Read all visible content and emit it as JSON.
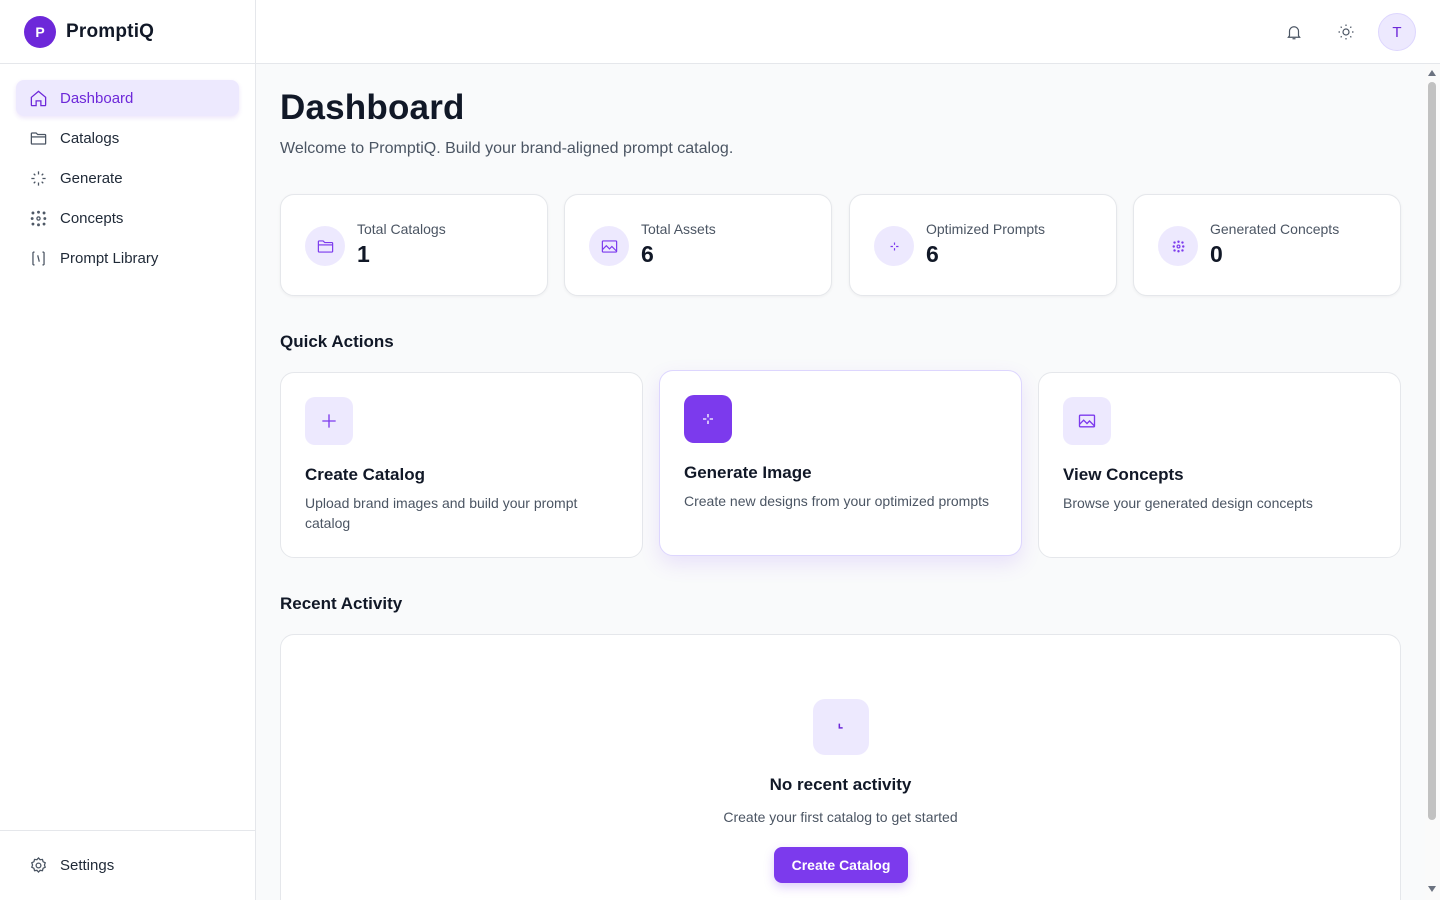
{
  "brand": {
    "logo_letter": "P",
    "name": "PromptiQ"
  },
  "sidebar": {
    "items": [
      {
        "label": "Dashboard",
        "icon": "home-icon",
        "active": true
      },
      {
        "label": "Catalogs",
        "icon": "folder-icon",
        "active": false
      },
      {
        "label": "Generate",
        "icon": "sparkles-icon",
        "active": false
      },
      {
        "label": "Concepts",
        "icon": "concepts-icon",
        "active": false
      },
      {
        "label": "Prompt Library",
        "icon": "library-icon",
        "active": false
      }
    ],
    "settings": {
      "label": "Settings",
      "icon": "gear-icon"
    }
  },
  "topbar": {
    "icons": [
      "bell-icon",
      "sun-icon"
    ],
    "avatar_letter": "T"
  },
  "page": {
    "title": "Dashboard",
    "subtitle": "Welcome to PromptiQ. Build your brand-aligned prompt catalog."
  },
  "stats": [
    {
      "label": "Total Catalogs",
      "value": "1",
      "icon": "folder-icon"
    },
    {
      "label": "Total Assets",
      "value": "6",
      "icon": "image-icon"
    },
    {
      "label": "Optimized Prompts",
      "value": "6",
      "icon": "sparkles-icon"
    },
    {
      "label": "Generated Concepts",
      "value": "0",
      "icon": "concepts-icon"
    }
  ],
  "quick_actions": {
    "title": "Quick Actions",
    "items": [
      {
        "title": "Create Catalog",
        "description": "Upload brand images and build your prompt catalog",
        "icon": "plus-icon"
      },
      {
        "title": "Generate Image",
        "description": "Create new designs from your optimized prompts",
        "icon": "sparkles-icon"
      },
      {
        "title": "View Concepts",
        "description": "Browse your generated design concepts",
        "icon": "image-icon"
      }
    ]
  },
  "recent_activity": {
    "title": "Recent Activity",
    "empty_title": "No recent activity",
    "empty_subtitle": "Create your first catalog to get started",
    "button_label": "Create Catalog",
    "icon": "clock-icon"
  },
  "colors": {
    "accent": "#7c3aed",
    "accent_dark": "#6d28d9",
    "accent_light": "#ede9fe"
  }
}
